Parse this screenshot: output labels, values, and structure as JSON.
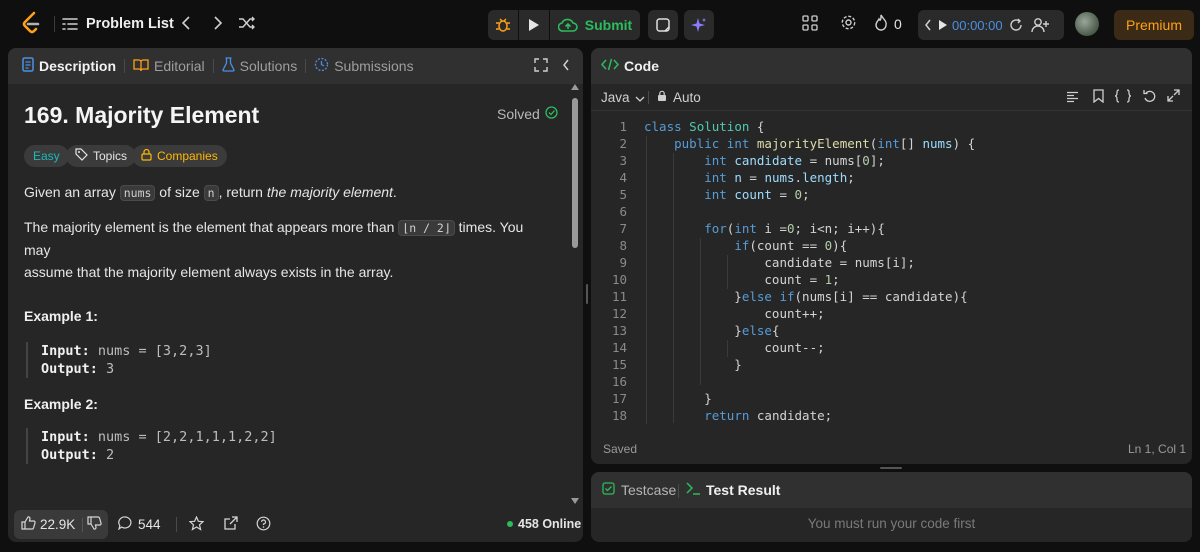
{
  "topbar": {
    "problem_list_label": "Problem List",
    "submit_label": "Submit",
    "streak_count": "0",
    "timer": "00:00:00",
    "premium_label": "Premium"
  },
  "tabs": {
    "description": "Description",
    "editorial": "Editorial",
    "solutions": "Solutions",
    "submissions": "Submissions"
  },
  "problem": {
    "title": "169. Majority Element",
    "solved_label": "Solved",
    "difficulty": "Easy",
    "topics_label": "Topics",
    "companies_label": "Companies",
    "p1_a": "Given an array ",
    "p1_code_nums": "nums",
    "p1_b": " of size ",
    "p1_code_n": "n",
    "p1_c": ", return ",
    "p1_em": "the majority element",
    "p1_d": ".",
    "p2_a": "The majority element is the element that appears more than ",
    "p2_code": "⌊n / 2⌋",
    "p2_b": " times. You may",
    "p2_line2": "assume that the majority element always exists in the array.",
    "examples": [
      {
        "heading": "Example 1:",
        "input_label": "Input:",
        "input_value": " nums = [3,2,3]",
        "output_label": "Output:",
        "output_value": " 3"
      },
      {
        "heading": "Example 2:",
        "input_label": "Input:",
        "input_value": " nums = [2,2,1,1,1,2,2]",
        "output_label": "Output:",
        "output_value": " 2"
      }
    ]
  },
  "footer": {
    "likes": "22.9K",
    "comments": "544",
    "online": "458 Online"
  },
  "code_panel": {
    "header_label": "Code",
    "language": "Java",
    "mode": "Auto",
    "status_saved": "Saved",
    "cursor_position": "Ln 1, Col 1",
    "line_numbers": [
      "1",
      "2",
      "3",
      "4",
      "5",
      "6",
      "7",
      "8",
      "9",
      "10",
      "11",
      "12",
      "13",
      "14",
      "15",
      "16",
      "17",
      "18"
    ]
  },
  "test_panel": {
    "testcase_label": "Testcase",
    "result_label": "Test Result",
    "message": "You must run your code first"
  },
  "colors": {
    "accent_green": "#2cbb5d",
    "difficulty_easy": "#1cbaba",
    "companies_gold": "#ffb800",
    "premium": "#ffa116",
    "timer_blue": "#007bff"
  }
}
